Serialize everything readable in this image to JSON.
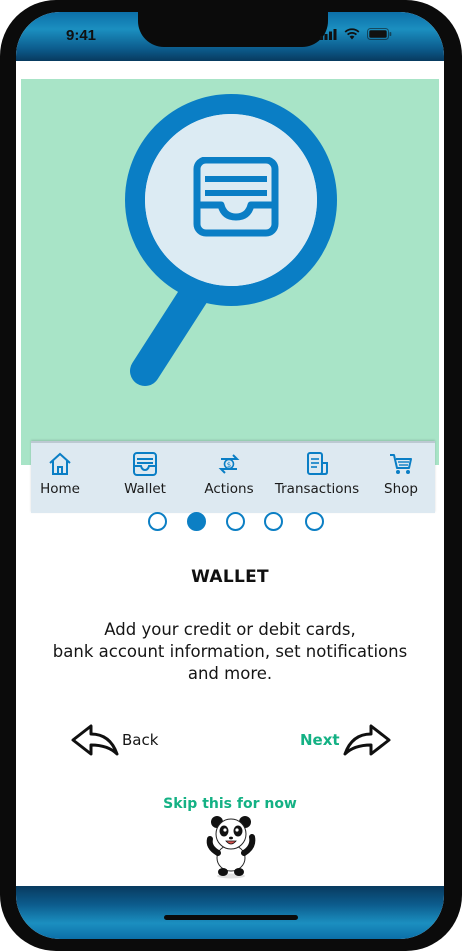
{
  "status_bar": {
    "time": "9:41",
    "icons": [
      "cellular-signal-icon",
      "wifi-icon",
      "battery-icon"
    ]
  },
  "hero": {
    "background": "#a8e4c7",
    "magnifier_icon": "magnifier-icon",
    "center_icon": "wallet-icon",
    "bottom_nav": [
      {
        "label": "Home",
        "icon": "home-icon"
      },
      {
        "label": "Wallet",
        "icon": "wallet-icon"
      },
      {
        "label": "Actions",
        "icon": "exchange-icon"
      },
      {
        "label": "Transactions",
        "icon": "receipt-icon"
      },
      {
        "label": "Shop",
        "icon": "cart-icon"
      }
    ]
  },
  "pager": {
    "total": 5,
    "active_index": 1
  },
  "content": {
    "title": "WALLET",
    "description_lines": [
      "Add your credit or debit cards,",
      "bank account information, set notifications",
      "and more."
    ]
  },
  "navigation": {
    "back_label": "Back",
    "next_label": "Next",
    "skip_label": "Skip this for now"
  },
  "colors": {
    "accent_blue": "#0c7fc4",
    "accent_green": "#14b184",
    "hero_bg": "#a8e4c7"
  }
}
